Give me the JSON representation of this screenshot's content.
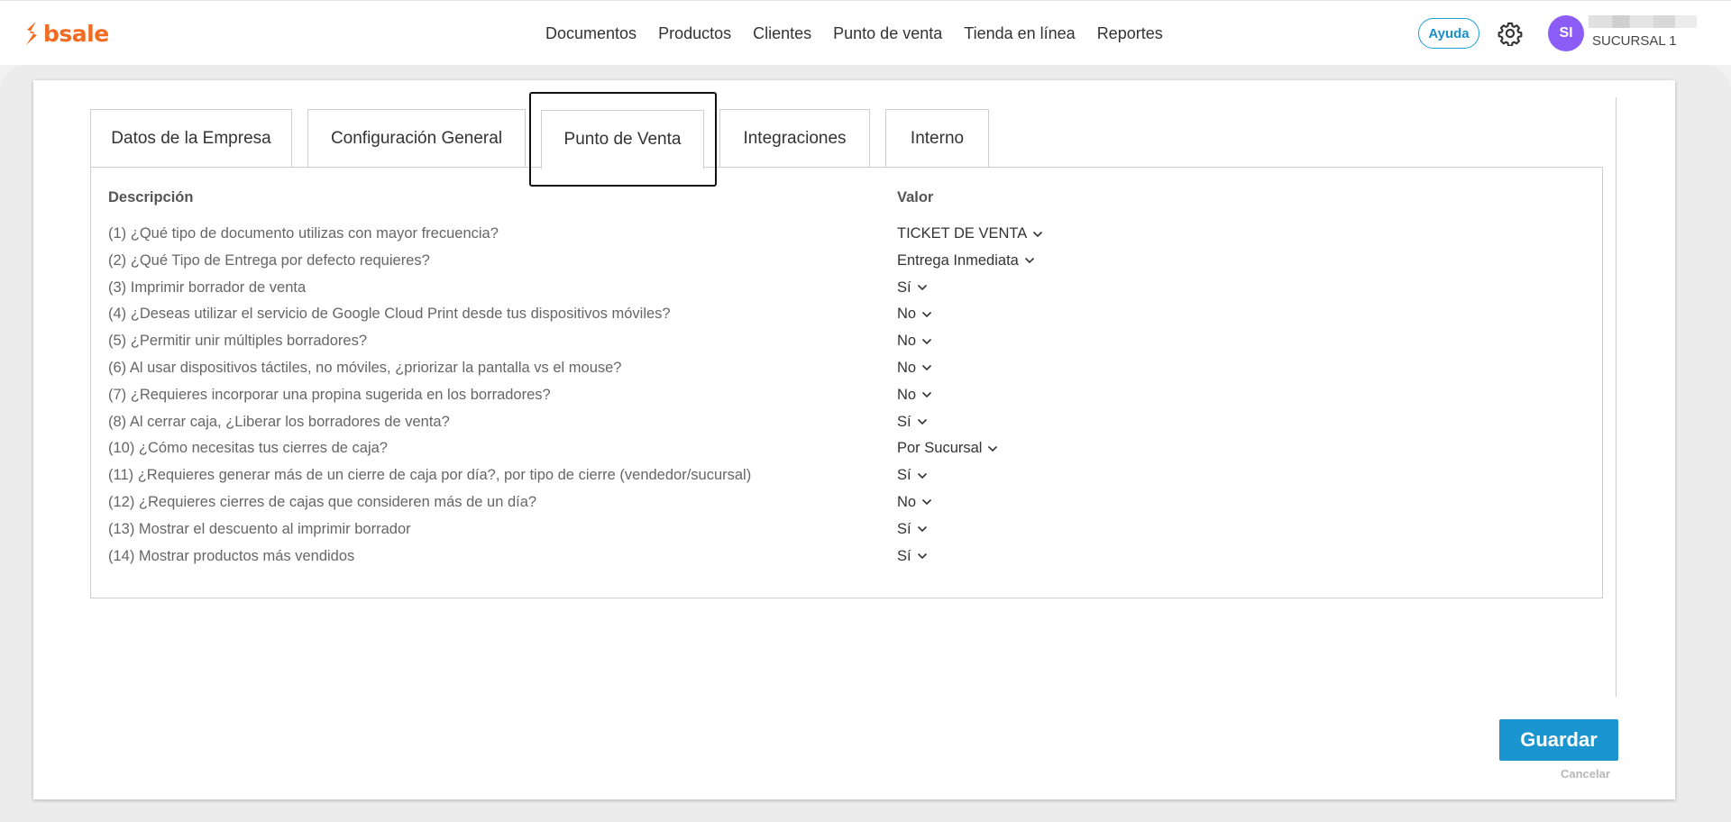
{
  "brand": {
    "name": "bsale",
    "color": "#f26b21"
  },
  "nav": {
    "items": [
      {
        "label": "Documentos"
      },
      {
        "label": "Productos"
      },
      {
        "label": "Clientes"
      },
      {
        "label": "Punto de venta"
      },
      {
        "label": "Tienda en línea"
      },
      {
        "label": "Reportes"
      }
    ]
  },
  "header": {
    "help_label": "Ayuda",
    "settings_icon": "gear-icon",
    "avatar_initials": "SI",
    "branch": "SUCURSAL 1"
  },
  "tabs": [
    {
      "label": "Datos de la Empresa",
      "active": false
    },
    {
      "label": "Configuración General",
      "active": false
    },
    {
      "label": "Punto de Venta",
      "active": true
    },
    {
      "label": "Integraciones",
      "active": false
    },
    {
      "label": "Interno",
      "active": false
    }
  ],
  "table": {
    "headers": {
      "description": "Descripción",
      "value": "Valor"
    },
    "rows": [
      {
        "description": "(1) ¿Qué tipo de documento utilizas con mayor frecuencia?",
        "value": "TICKET DE VENTA"
      },
      {
        "description": "(2) ¿Qué Tipo de Entrega por defecto requieres?",
        "value": "Entrega Inmediata"
      },
      {
        "description": "(3) Imprimir borrador de venta",
        "value": "Sí"
      },
      {
        "description": "(4) ¿Deseas utilizar el servicio de Google Cloud Print desde tus dispositivos móviles?",
        "value": "No"
      },
      {
        "description": "(5) ¿Permitir unir múltiples borradores?",
        "value": "No"
      },
      {
        "description": "(6) Al usar dispositivos táctiles, no móviles, ¿priorizar la pantalla vs el mouse?",
        "value": "No"
      },
      {
        "description": "(7) ¿Requieres incorporar una propina sugerida en los borradores?",
        "value": "No"
      },
      {
        "description": "(8) Al cerrar caja, ¿Liberar los borradores de venta?",
        "value": "Sí"
      },
      {
        "description": "(10) ¿Cómo necesitas tus cierres de caja?",
        "value": "Por Sucursal"
      },
      {
        "description": "(11) ¿Requieres generar más de un cierre de caja por día?, por tipo de cierre (vendedor/sucursal)",
        "value": "Sí"
      },
      {
        "description": "(12) ¿Requieres cierres de cajas que consideren más de un día?",
        "value": "No"
      },
      {
        "description": "(13) Mostrar el descuento al imprimir borrador",
        "value": "Sí"
      },
      {
        "description": "(14) Mostrar productos más vendidos",
        "value": "Sí"
      }
    ]
  },
  "actions": {
    "save_label": "Guardar",
    "cancel_label": "Cancelar",
    "save_color": "#1b95cf"
  }
}
